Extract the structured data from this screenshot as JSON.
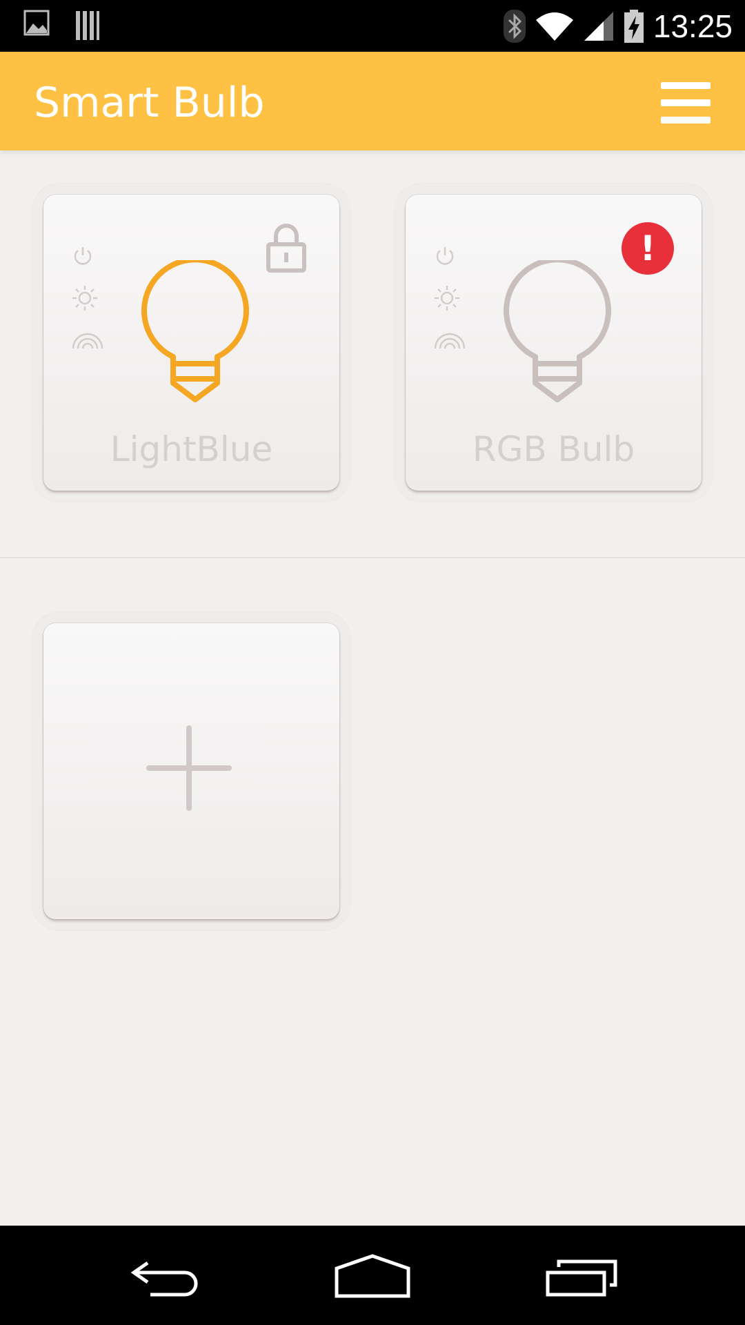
{
  "status_bar": {
    "time": "13:25",
    "icons": [
      "image-icon",
      "sdcard-icon",
      "bluetooth-icon",
      "wifi-icon",
      "signal-icon",
      "battery-charging-icon"
    ]
  },
  "app_bar": {
    "title": "Smart Bulb",
    "menu_icon": "hamburger-menu-icon"
  },
  "bulbs": [
    {
      "name": "LightBlue",
      "state": "on",
      "badge": "lock-icon",
      "bulb_color": "#f5a623"
    },
    {
      "name": "RGB Bulb",
      "state": "off",
      "badge": "alert-icon",
      "badge_text": "!",
      "bulb_color": "#c9c0be"
    }
  ],
  "add_card": {
    "icon": "plus-icon"
  },
  "nav_bar": {
    "buttons": [
      "back-icon",
      "home-icon",
      "recents-icon"
    ]
  },
  "colors": {
    "accent": "#ffc143",
    "alert": "#e8303b",
    "background": "#f2f0ee"
  }
}
